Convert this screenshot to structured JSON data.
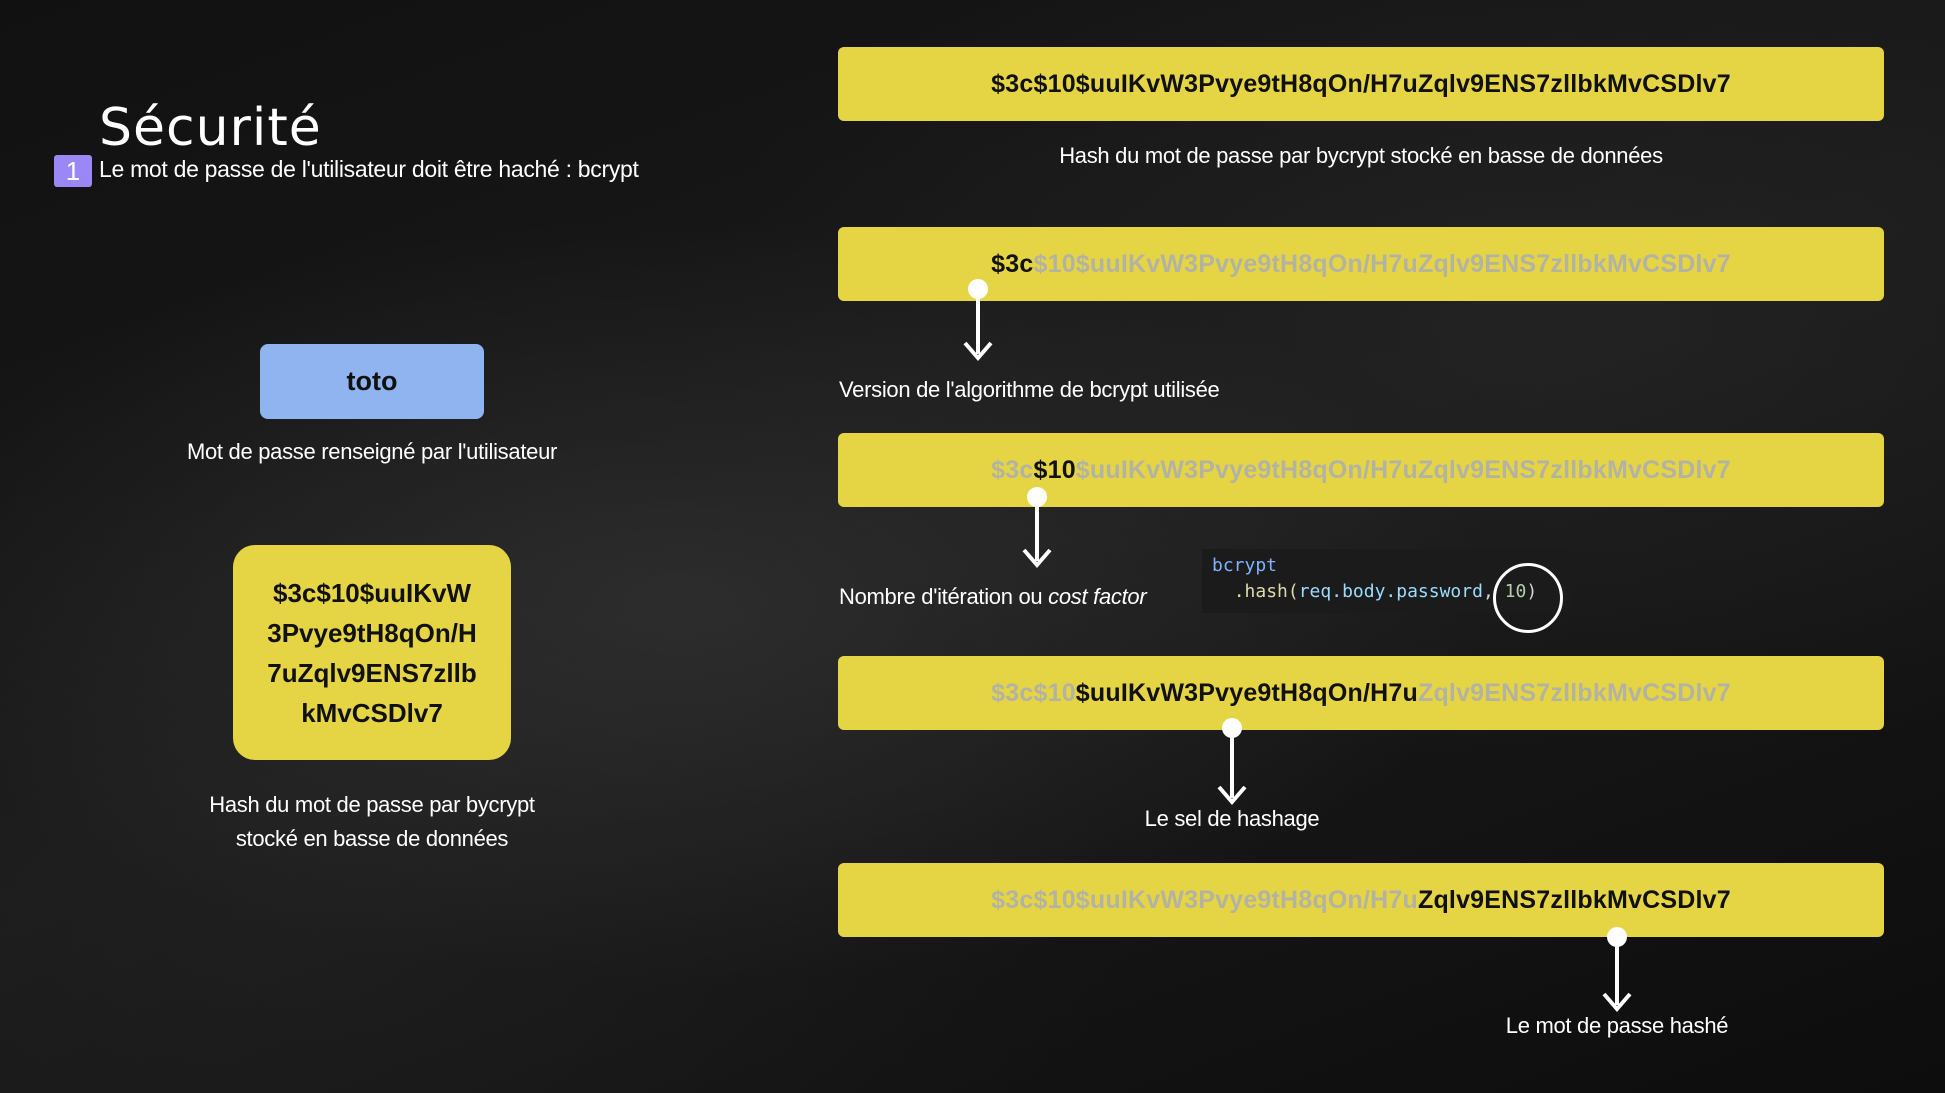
{
  "slide": {
    "title": "Sécurité",
    "badge_number": "1",
    "subtitle": "Le mot de passe de l'utilisateur doit être haché : bcrypt"
  },
  "left": {
    "password": "toto",
    "password_caption": "Mot de passe renseigné par l'utilisateur",
    "hash_lines": [
      "$3c$10$uuIKvW",
      "3Pvye9tH8qOn/H",
      "7uZqlv9ENS7zllb",
      "kMvCSDlv7"
    ],
    "hash_caption_line1": "Hash du mot de passe par bycrypt",
    "hash_caption_line2": "stocké en basse de données"
  },
  "right": {
    "full_hash": "$3c$10$uuIKvW3Pvye9tH8qOn/H7uZqlv9ENS7zllbkMvCSDlv7",
    "full_hash_caption": "Hash du mot de passe par bycrypt stocké en basse de données",
    "version": {
      "highlight": "$3c",
      "rest": "$10$uuIKvW3Pvye9tH8qOn/H7uZqlv9ENS7zllbkMvCSDlv7",
      "caption": "Version de l'algorithme de bcrypt utilisée"
    },
    "cost": {
      "before": "$3c",
      "highlight": "$10",
      "after": "$uuIKvW3Pvye9tH8qOn/H7uZqlv9ENS7zllbkMvCSDlv7",
      "caption_plain": "Nombre d'itération ou ",
      "caption_italic": "cost factor"
    },
    "salt": {
      "before": "$3c$10",
      "highlight": "$uuIKvW3Pvye9tH8qOn/H7u",
      "after": "Zqlv9ENS7zllbkMvCSDlv7",
      "caption": "Le sel de hashage"
    },
    "hashed": {
      "before": "$3c$10$uuIKvW3Pvye9tH8qOn/H7u",
      "highlight": "Zqlv9ENS7zllbkMvCSDlv7",
      "caption": "Le mot de passe hashé"
    }
  },
  "code": {
    "line1": "bcrypt",
    "line2_fn": ".hash(",
    "line2_arg": "req.body.password",
    "line2_sep": ", ",
    "line2_num": "10",
    "line2_close": ")"
  },
  "colors": {
    "bar_yellow": "#e5d545",
    "password_blue": "#8fb4f0",
    "badge_purple": "#9b87f5",
    "dim_text": "#b3b3a4"
  }
}
